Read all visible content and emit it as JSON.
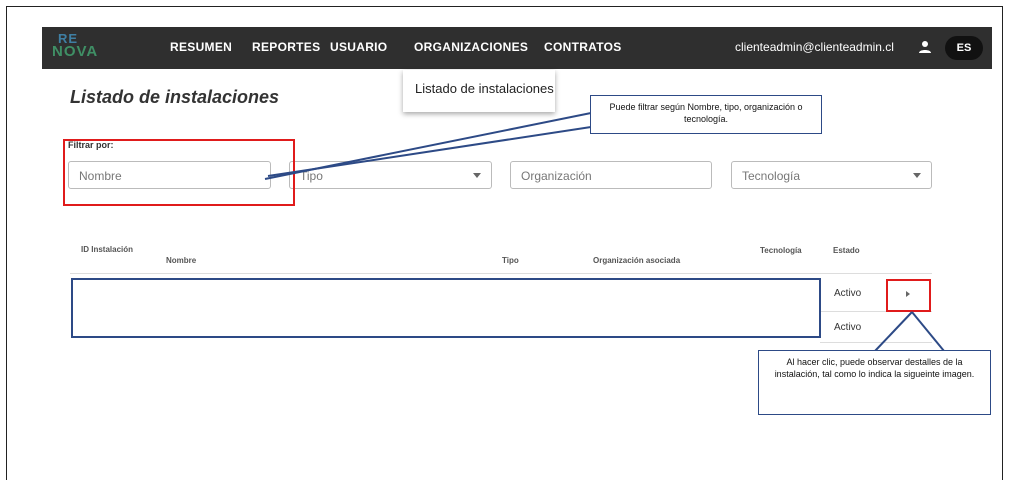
{
  "brand": {
    "logo_line1": "RE",
    "logo_line2": "NOVA"
  },
  "nav": {
    "items": [
      "RESUMEN",
      "REPORTES",
      "USUARIO",
      "ORGANIZACIONES",
      "CONTRATOS"
    ],
    "user_email": "clienteadmin@clienteadmin.cl",
    "language": "ES"
  },
  "dropdown": {
    "item": "Listado de instalaciones"
  },
  "page": {
    "title": "Listado de instalaciones"
  },
  "filters": {
    "label": "Filtrar por:",
    "nombre": "Nombre",
    "tipo": "Tipo",
    "organizacion": "Organización",
    "tecnologia": "Tecnología"
  },
  "table": {
    "headers": [
      "ID Instalación",
      "Nombre",
      "Tipo",
      "Organización asociada",
      "Tecnología",
      "Estado"
    ],
    "rows": [
      {
        "estado": "Activo"
      },
      {
        "estado": "Activo"
      }
    ]
  },
  "callouts": {
    "filter": "Puede filtrar según Nombre, tipo, organización o tecnología.",
    "detail": "Al hacer clic, puede observar destalles de la instalación, tal como lo indica la sigueinte imagen."
  },
  "colors": {
    "topbar": "#2f2f2f",
    "highlight_red": "#e01b1b",
    "annotation_blue": "#2d4a86"
  }
}
